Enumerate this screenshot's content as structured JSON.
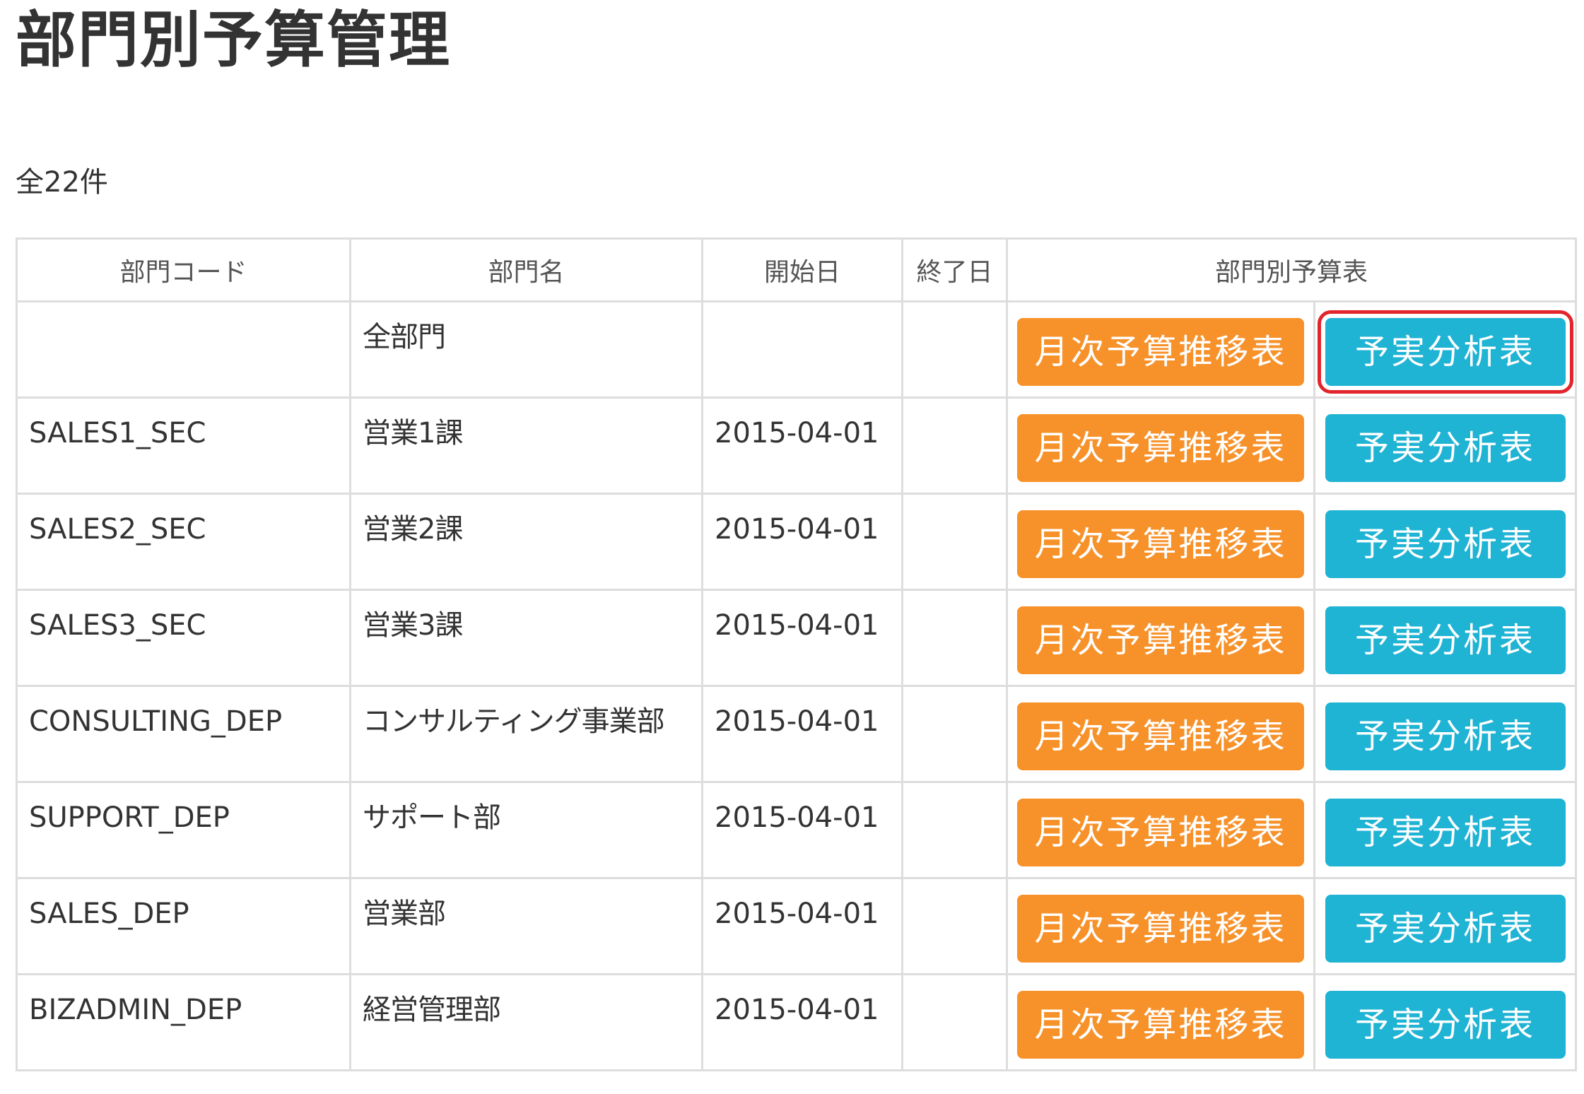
{
  "page": {
    "title": "部門別予算管理",
    "count_label": "全22件"
  },
  "table": {
    "headers": {
      "code": "部門コード",
      "name": "部門名",
      "start": "開始日",
      "end": "終了日",
      "budget": "部門別予算表"
    },
    "button_labels": {
      "monthly": "月次予算推移表",
      "analysis": "予実分析表"
    },
    "rows": [
      {
        "code": "",
        "name": "全部門",
        "start": "",
        "end": "",
        "highlighted": true
      },
      {
        "code": "SALES1_SEC",
        "name": "営業1課",
        "start": "2015-04-01",
        "end": ""
      },
      {
        "code": "SALES2_SEC",
        "name": "営業2課",
        "start": "2015-04-01",
        "end": ""
      },
      {
        "code": "SALES3_SEC",
        "name": "営業3課",
        "start": "2015-04-01",
        "end": ""
      },
      {
        "code": "CONSULTING_DEP",
        "name": "コンサルティング事業部",
        "start": "2015-04-01",
        "end": ""
      },
      {
        "code": "SUPPORT_DEP",
        "name": "サポート部",
        "start": "2015-04-01",
        "end": ""
      },
      {
        "code": "SALES_DEP",
        "name": "営業部",
        "start": "2015-04-01",
        "end": ""
      },
      {
        "code": "BIZADMIN_DEP",
        "name": "経営管理部",
        "start": "2015-04-01",
        "end": ""
      }
    ]
  },
  "colors": {
    "monthly_button": "#f7922b",
    "analysis_button": "#1fb3d4",
    "highlight_outline": "#e2242c",
    "border": "#dddddd"
  }
}
